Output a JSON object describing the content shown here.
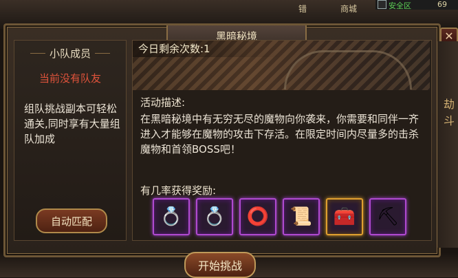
{
  "hud": {
    "safe_zone": "安全区",
    "level": "69",
    "badge_left": "错",
    "badge_right": "商城"
  },
  "window": {
    "title": "黑暗秘境",
    "close_label": "✕"
  },
  "side_strip": {
    "glyph": "劫斗"
  },
  "team_panel": {
    "header": "小队成员",
    "status": "当前没有队友",
    "description": "组队挑战副本可轻松通关,同时享有大量组队加成",
    "auto_match_label": "自动匹配"
  },
  "dungeon": {
    "remaining_label": "今日剩余次数:1",
    "desc_title": "活动描述:",
    "desc_body": "在黑暗秘境中有无穷无尽的魔物向你袭来，你需要和同伴一齐进入才能够在魔物的攻击下存活。在限定时间内尽量多的击杀魔物和首领BOSS吧！",
    "reward_title": "有几率获得奖励:",
    "rewards": [
      {
        "icon": "gem-ring-icon",
        "glyph": "💍",
        "rarity": "purple"
      },
      {
        "icon": "ruby-ring-icon",
        "glyph": "💍",
        "rarity": "purple"
      },
      {
        "icon": "jade-ring-icon",
        "glyph": "⭕",
        "rarity": "purple"
      },
      {
        "icon": "scroll-icon",
        "glyph": "📜",
        "rarity": "purple"
      },
      {
        "icon": "treasure-chest-icon",
        "glyph": "🧰",
        "rarity": "gold"
      },
      {
        "icon": "ore-icon",
        "glyph": "⛏",
        "rarity": "purple"
      }
    ],
    "start_label": "开始挑战"
  },
  "colors": {
    "purple_rarity": "#b04ad0",
    "gold_rarity": "#e0a030",
    "status_red": "#e0533b"
  }
}
